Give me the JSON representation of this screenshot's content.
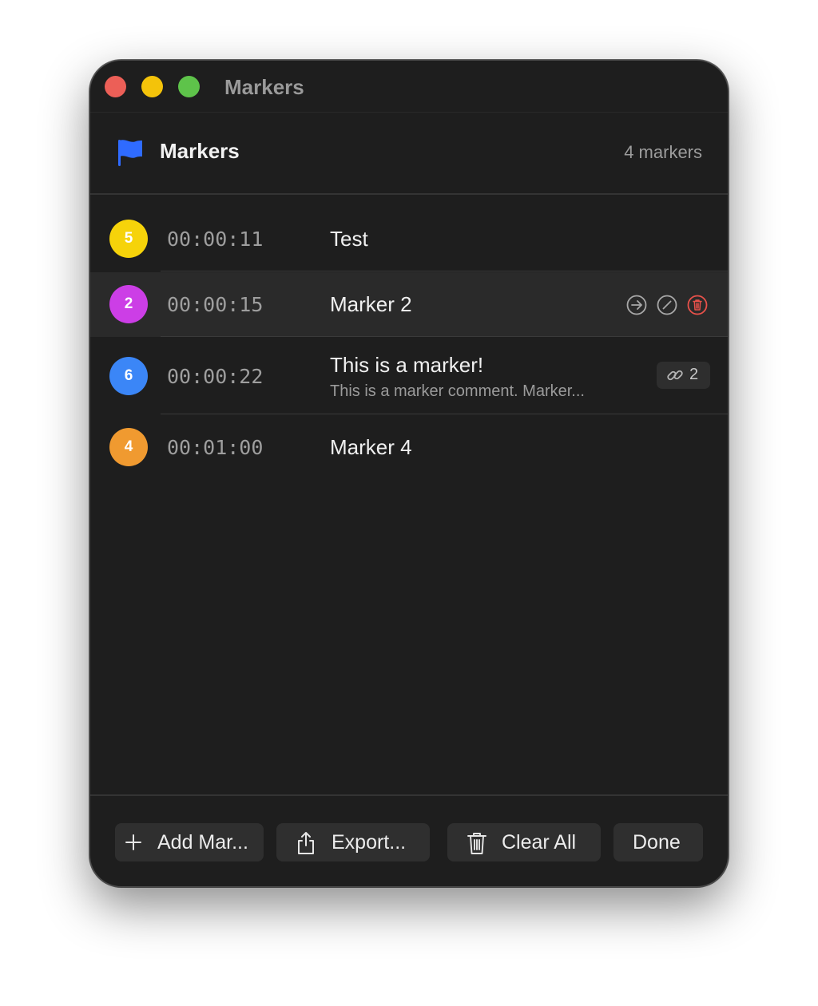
{
  "window": {
    "title": "Markers"
  },
  "header": {
    "title": "Markers",
    "count": "4 markers",
    "accent": "#2f6bff"
  },
  "markers": [
    {
      "number": "5",
      "time": "00:00:11",
      "name": "Test",
      "comment": "",
      "color": "#f6d30a"
    },
    {
      "number": "2",
      "time": "00:00:15",
      "name": "Marker 2",
      "comment": "",
      "color": "#cc3ee6",
      "selected": true
    },
    {
      "number": "6",
      "time": "00:00:22",
      "name": "This is a marker!",
      "comment": "This is a marker comment. Marker...",
      "color": "#3b86f7",
      "links": "2"
    },
    {
      "number": "4",
      "time": "00:01:00",
      "name": "Marker 4",
      "comment": "",
      "color": "#f09a30"
    }
  ],
  "row_actions": {
    "icons": [
      "go-to-icon",
      "disable-icon",
      "delete-icon"
    ],
    "delete_color": "#e8514a"
  },
  "footer": {
    "add_label": "Add Mar...",
    "export_label": "Export...",
    "clear_label": "Clear All",
    "done_label": "Done"
  }
}
